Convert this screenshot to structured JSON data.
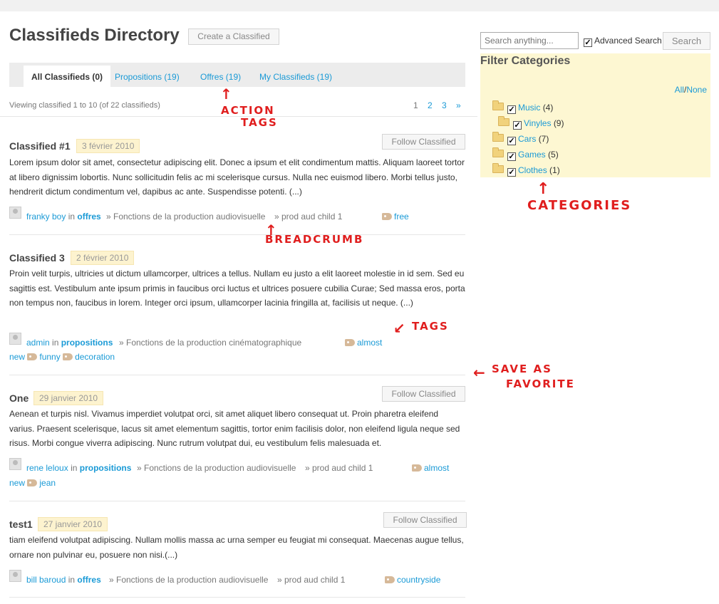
{
  "header": {
    "title": "Classifieds Directory",
    "create_button": "Create a Classified"
  },
  "tabs": [
    {
      "label": "All Classifieds (0)",
      "active": true
    },
    {
      "label": "Propositions (19)"
    },
    {
      "label": "Offres (19)"
    },
    {
      "label": "My Classifieds (19)"
    }
  ],
  "listing": {
    "viewing_text": "Viewing classified 1 to 10 (of 22 classifieds)",
    "pages": [
      "1",
      "2",
      "3",
      "»"
    ]
  },
  "classifieds": [
    {
      "title": "Classified #1",
      "date": "3 février 2010",
      "follow_label": "Follow Classified",
      "description": "Lorem ipsum dolor sit amet, consectetur adipiscing elit. Donec a ipsum et elit condimentum mattis. Aliquam laoreet tortor at libero dignissim lobortis. Nunc sollicitudin felis ac mi scelerisque cursus. Nulla nec euismod libero. Morbi tellus justo, hendrerit dictum condimentum vel, dapibus ac ante. Suspendisse potenti. (...)",
      "author": "franky boy",
      "in": "in",
      "category": "offres",
      "crumb1": "» Fonctions de la production audiovisuelle",
      "crumb2": "» prod aud child 1",
      "tag1": "free"
    },
    {
      "title": "Classified 3",
      "date": "2 février 2010",
      "description": "Proin velit turpis, ultricies ut dictum ullamcorper, ultrices a tellus. Nullam eu justo a elit laoreet molestie in id sem. Sed eu sagittis est. Vestibulum ante ipsum primis in faucibus orci luctus et ultrices posuere cubilia Curae; Sed massa eros, porta non tempus non, faucibus in lorem. Integer orci ipsum, ullamcorper lacinia fringilla at, facilisis ut neque. (...)",
      "author": "admin",
      "in": "in",
      "category": "propositions",
      "crumb1": "» Fonctions de la production cinématographique",
      "tag1": "almost",
      "tag1_cont": "new",
      "tag2": "funny",
      "tag3": "decoration"
    },
    {
      "title": "One",
      "date": "29 janvier 2010",
      "follow_label": "Follow Classified",
      "description": "Aenean et turpis nisl. Vivamus imperdiet volutpat orci, sit amet aliquet libero consequat ut. Proin pharetra eleifend varius. Praesent scelerisque, lacus sit amet elementum sagittis, tortor enim facilisis dolor, non eleifend ligula neque sed risus. Morbi congue viverra adipiscing. Nunc rutrum volutpat dui, eu vestibulum felis malesuada et.",
      "author": "rene leloux",
      "in": "in",
      "category": "propositions",
      "crumb1": "» Fonctions de la production audiovisuelle",
      "crumb2": "» prod aud child 1",
      "tag1": "almost",
      "tag1_cont": "new",
      "tag2": "jean"
    },
    {
      "title": "test1",
      "date": "27 janvier 2010",
      "follow_label": "Follow Classified",
      "description": "tiam eleifend volutpat adipiscing. Nullam mollis massa ac urna semper eu feugiat mi consequat. Maecenas augue tellus, ornare non pulvinar eu, posuere non nisi.(...)",
      "author": "bill baroud",
      "in": "in",
      "category": "offres",
      "crumb1": "» Fonctions de la production audiovisuelle",
      "crumb2": "» prod aud child 1",
      "tag1": "countryside"
    }
  ],
  "sidebar": {
    "search_placeholder": "Search anything...",
    "advanced_label": "Advanced Search",
    "search_button": "Search",
    "filter_title": "Filter Categories",
    "all_label": "All",
    "sep": "/",
    "none_label": "None",
    "categories": [
      {
        "name": "Music",
        "count": "(4)"
      },
      {
        "name": "Vinyles",
        "count": "(9)"
      },
      {
        "name": "Cars",
        "count": "(7)"
      },
      {
        "name": "Games",
        "count": "(5)"
      },
      {
        "name": "Clothes",
        "count": "(1)"
      }
    ]
  },
  "annotations": {
    "action_tags_1": "ACTION",
    "action_tags_2": "TAGS",
    "categories": "CATEGORIES",
    "breadcrumb": "BREADCRUMB",
    "tags": "TAGS",
    "save_fav_1": "SAVE AS",
    "save_fav_2": "FAVORITE",
    "arrow_up": "↑",
    "arrow_diag": "↙",
    "arrow_left": "←"
  }
}
